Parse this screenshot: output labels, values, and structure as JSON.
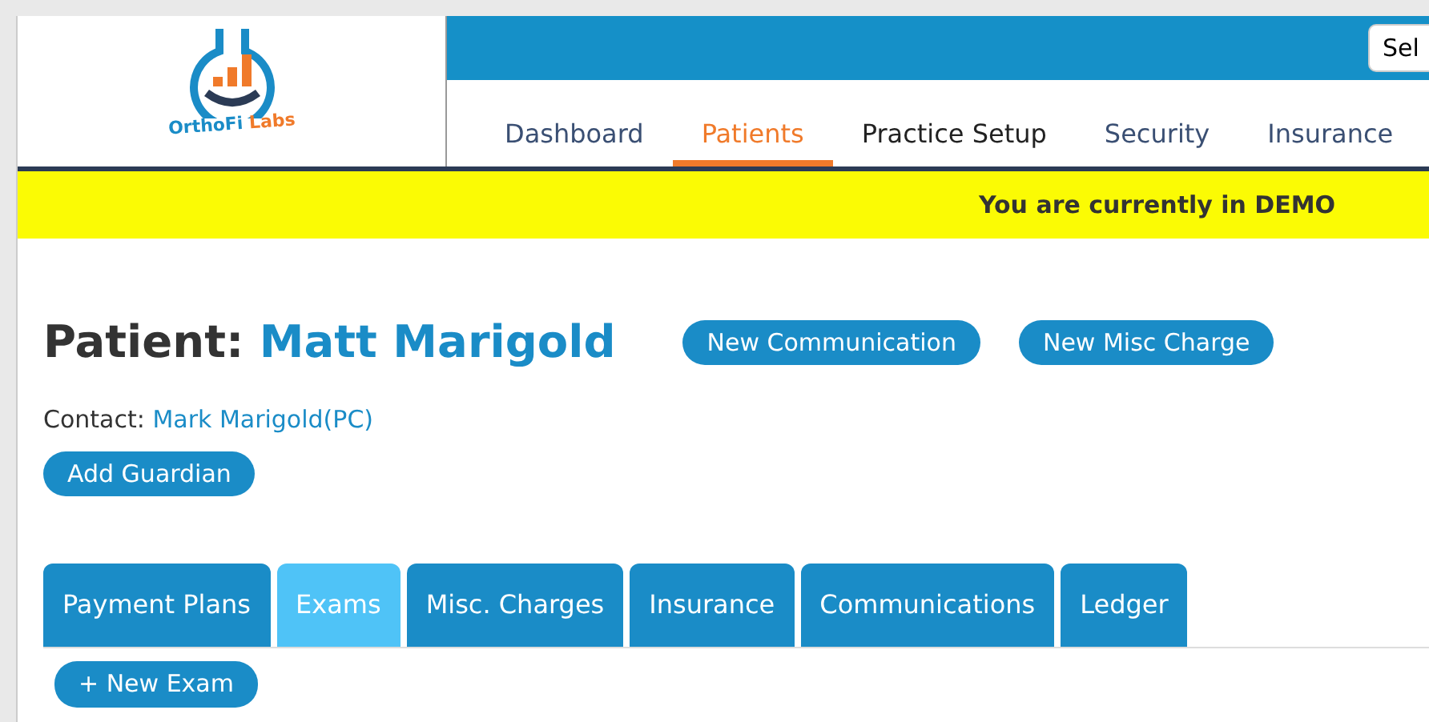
{
  "logo": {
    "parts": [
      "OrthoFi",
      "Labs"
    ]
  },
  "header_select": {
    "value": "Sel"
  },
  "nav": [
    {
      "label": "Dashboard",
      "selected": false
    },
    {
      "label": "Patients",
      "selected": true
    },
    {
      "label": "Practice Setup",
      "selected": false
    },
    {
      "label": "Security",
      "selected": false
    },
    {
      "label": "Insurance",
      "selected": false
    }
  ],
  "banner": "You are currently in DEMO",
  "patient": {
    "label": "Patient:",
    "name": "Matt Marigold"
  },
  "actions": [
    "New Communication",
    "New Misc Charge"
  ],
  "contact": {
    "label": "Contact:",
    "name": "Mark Marigold(PC)"
  },
  "add_guardian": "Add Guardian",
  "tabs": [
    {
      "label": "Payment Plans",
      "selected": false
    },
    {
      "label": "Exams",
      "selected": true
    },
    {
      "label": "Misc. Charges",
      "selected": false
    },
    {
      "label": "Insurance",
      "selected": false
    },
    {
      "label": "Communications",
      "selected": false
    },
    {
      "label": "Ledger",
      "selected": false
    }
  ],
  "new_exam": "+ New Exam"
}
